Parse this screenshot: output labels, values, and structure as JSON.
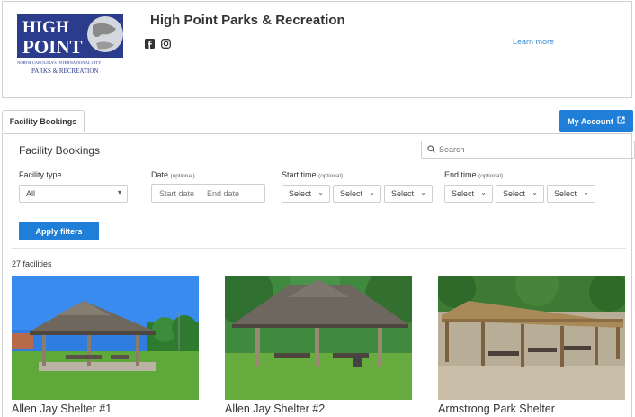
{
  "header": {
    "logo_lines": [
      "HIGH",
      "POINT",
      "NORTH CAROLINA'S INTERNATIONAL CITY",
      "PARKS & RECREATION"
    ],
    "org_title": "High Point Parks & Recreation",
    "social_icons": [
      "facebook-icon",
      "instagram-icon"
    ],
    "learn_more": "Learn more"
  },
  "tabs": {
    "bookings": "Facility Bookings"
  },
  "account": {
    "label": "My Account"
  },
  "panel": {
    "title": "Facility Bookings",
    "search_placeholder": "Search",
    "filters": {
      "facility_type": {
        "label": "Facility type",
        "value": "All"
      },
      "date": {
        "label": "Date",
        "optional": "(optional)",
        "start_placeholder": "Start date",
        "end_placeholder": "End date"
      },
      "start_time": {
        "label": "Start time",
        "optional": "(optional)",
        "selects": [
          "Select",
          "Select",
          "Select"
        ]
      },
      "end_time": {
        "label": "End time",
        "optional": "(optional)",
        "selects": [
          "Select",
          "Select",
          "Select"
        ]
      }
    },
    "apply_label": "Apply filters",
    "count_text": "27 facilities"
  },
  "facilities": [
    {
      "name": "Allen Jay Shelter #1"
    },
    {
      "name": "Allen Jay Shelter #2"
    },
    {
      "name": "Armstrong Park Shelter"
    }
  ],
  "colors": {
    "accent": "#1f7fd8",
    "link": "#3b8fd6",
    "border": "#cfcfcf",
    "logo_blue": "#2b3c8c"
  }
}
